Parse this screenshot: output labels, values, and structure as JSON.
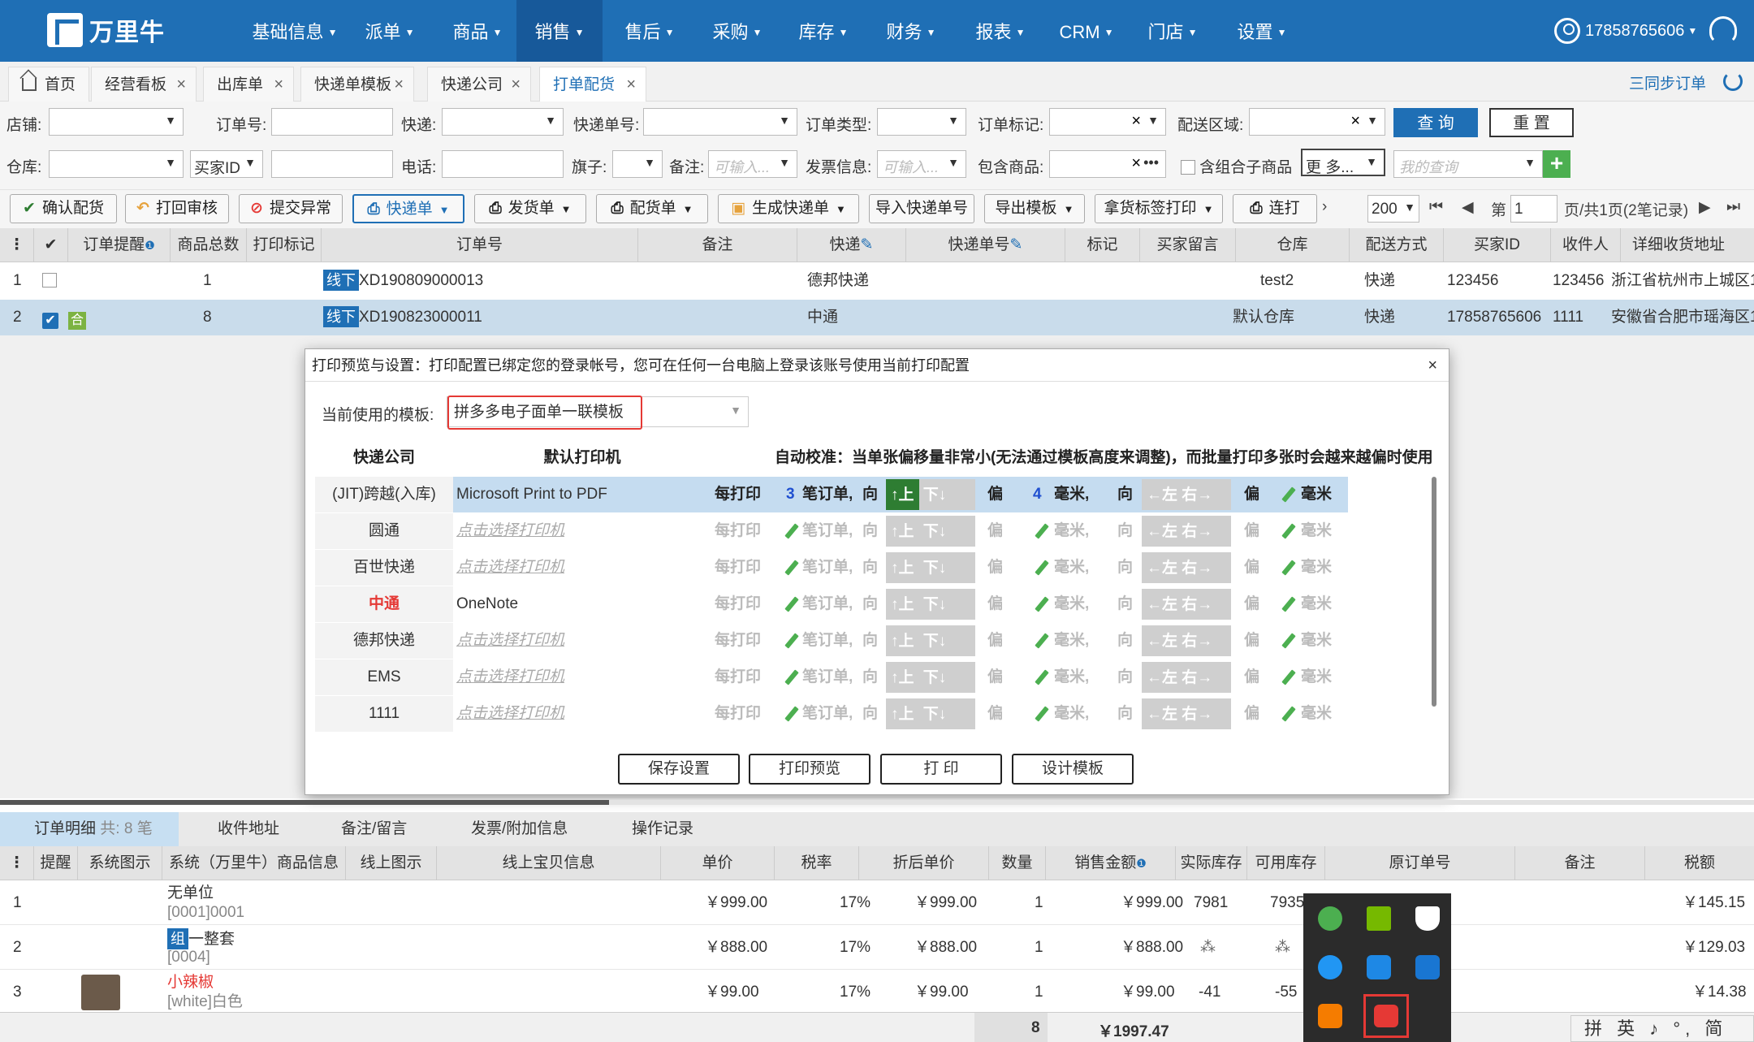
{
  "app": {
    "brand": "万里牛",
    "user": "17858765606"
  },
  "nav": {
    "items": [
      "基础信息",
      "派单",
      "商品",
      "销售",
      "售后",
      "采购",
      "库存",
      "财务",
      "报表",
      "CRM",
      "门店",
      "设置"
    ],
    "active": "销售"
  },
  "tabs": [
    {
      "label": "首页"
    },
    {
      "label": "经营看板"
    },
    {
      "label": "出库单"
    },
    {
      "label": "快递单模板"
    },
    {
      "label": "快递公司"
    },
    {
      "label": "打单配货"
    }
  ],
  "sync_label": "三同步订单",
  "filters": {
    "shop": "店铺:",
    "order_no": "订单号:",
    "express": "快递:",
    "express_no": "快递单号:",
    "order_type": "订单类型:",
    "order_mark": "订单标记:",
    "region": "配送区域:",
    "warehouse": "仓库:",
    "buyer_id": "买家ID",
    "phone": "电话:",
    "flag": "旗子:",
    "remark": "备注:",
    "remark_ph": "可输入...",
    "invoice": "发票信息:",
    "invoice_ph": "可输入...",
    "contains": "包含商品:",
    "combo": "含组合子商品",
    "more": "更 多...",
    "my_query_ph": "我的查询",
    "query_btn": "查 询",
    "reset_btn": "重 置"
  },
  "toolbar": {
    "confirm": "确认配货",
    "print_review": "打回审核",
    "submit_exception": "提交异常",
    "express_doc": "快递单",
    "delivery_doc": "发货单",
    "pick_doc": "配货单",
    "gen_express": "生成快递单",
    "import_express": "导入快递单号",
    "export_tpl": "导出模板",
    "pick_label": "拿货标签打印",
    "continuous": "连打",
    "page_size": "200",
    "page_prefix": "第",
    "page_num": "1",
    "page_info": "页/共1页(2笔记录)"
  },
  "grid": {
    "headers": [
      "订单提醒",
      "商品总数",
      "打印标记",
      "订单号",
      "备注",
      "快递",
      "快递单号",
      "标记",
      "买家留言",
      "仓库",
      "配送方式",
      "买家ID",
      "收件人",
      "详细收货地址"
    ],
    "rows": [
      {
        "idx": "1",
        "qty": "1",
        "tag": "线下",
        "order": "XD190809000013",
        "express": "德邦快递",
        "wh": "test2",
        "ship": "快递",
        "buyer": "123456",
        "recv": "123456",
        "addr": "浙江省杭州市上城区1"
      },
      {
        "idx": "2",
        "he": "合",
        "qty": "8",
        "tag": "线下",
        "order": "XD190823000011",
        "express": "中通",
        "wh": "默认仓库",
        "ship": "快递",
        "buyer": "17858765606",
        "recv": "1111",
        "addr": "安徽省合肥市瑶海区1"
      }
    ]
  },
  "modal": {
    "title": "打印预览与设置：打印配置已绑定您的登录帐号，您可在任何一台电脑上登录该账号使用当前打印配置",
    "tpl_label": "当前使用的模板:",
    "tpl_value": "拼多多电子面单一联模板",
    "col_company": "快递公司",
    "col_printer": "默认打印机",
    "col_calib": "自动校准：当单张偏移量非常小(无法通过模板高度来调整)，而批量打印多张时会越来越偏时使用",
    "every": "每打印",
    "per": "笔订单,",
    "dir": "向",
    "up": "↑上",
    "down": "下↓",
    "off": "偏",
    "mm": "毫米,",
    "left": "←左",
    "right": "右→",
    "mm2": "毫米",
    "rows": [
      {
        "company": "(JIT)跨越(入库)",
        "printer": "Microsoft Print to PDF",
        "n1": "3",
        "n2": "4"
      },
      {
        "company": "圆通",
        "printer": "点击选择打印机"
      },
      {
        "company": "百世快递",
        "printer": "点击选择打印机"
      },
      {
        "company": "中通",
        "printer": "OneNote"
      },
      {
        "company": "德邦快递",
        "printer": "点击选择打印机"
      },
      {
        "company": "EMS",
        "printer": "点击选择打印机"
      },
      {
        "company": "1111",
        "printer": "点击选择打印机"
      }
    ],
    "btn_save": "保存设置",
    "btn_preview": "打印预览",
    "btn_print": "打 印",
    "btn_design": "设计模板"
  },
  "bottom": {
    "tabs": [
      "订单明细",
      "收件地址",
      "备注/留言",
      "发票/附加信息",
      "操作记录"
    ],
    "count": "共: 8 笔",
    "headers": [
      "提醒",
      "系统图示",
      "系统（万里牛）商品信息",
      "线上图示",
      "线上宝贝信息",
      "单价",
      "税率",
      "折后单价",
      "数量",
      "销售金额",
      "实际库存",
      "可用库存",
      "原订单号",
      "备注",
      "税额"
    ],
    "rows": [
      {
        "idx": "1",
        "name": "无单位",
        "code": "[0001]0001",
        "price": "￥999.00",
        "tax": "17%",
        "disc": "￥999.00",
        "qty": "1",
        "amt": "￥999.00",
        "stock": "7981",
        "avail": "7935",
        "taxamt": "￥145.15"
      },
      {
        "idx": "2",
        "tag": "组",
        "name": "一整套",
        "code": "[0004]",
        "price": "￥888.00",
        "tax": "17%",
        "disc": "￥888.00",
        "qty": "1",
        "amt": "￥888.00",
        "taxamt": "￥129.03"
      },
      {
        "idx": "3",
        "name": "小辣椒",
        "code": "[white]白色",
        "price": "￥99.00",
        "tax": "17%",
        "disc": "￥99.00",
        "qty": "1",
        "amt": "￥99.00",
        "stock": "-41",
        "avail": "-55",
        "taxamt": "￥14.38"
      }
    ],
    "total_qty": "8",
    "total_amt": "￥1997.47"
  },
  "ime": "拼 英 ♪ °, 简 ⚙"
}
